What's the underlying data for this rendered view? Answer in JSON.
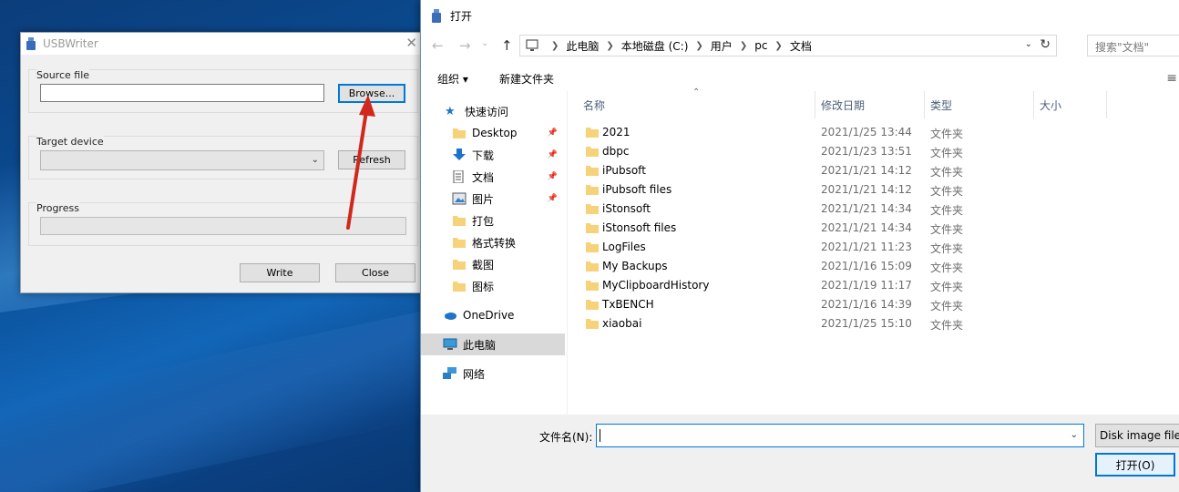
{
  "usbwriter": {
    "title": "USBWriter",
    "close_glyph": "✕",
    "source_file": {
      "label": "Source file",
      "value": "",
      "browse_label": "Browse..."
    },
    "target_device": {
      "label": "Target device",
      "selected": "",
      "refresh_label": "Refresh"
    },
    "progress": {
      "label": "Progress",
      "value_fraction": 0
    },
    "write_label": "Write",
    "close_label": "Close"
  },
  "dialog": {
    "title": "打开",
    "breadcrumb": [
      "此电脑",
      "本地磁盘 (C:)",
      "用户",
      "pc",
      "文档"
    ],
    "search_placeholder": "搜索\"文档\"",
    "toolbar": {
      "organize_label": "组织 ▾",
      "new_folder_label": "新建文件夹"
    },
    "nav": {
      "quick_access": "快速访问",
      "quick_items": [
        {
          "label": "Desktop",
          "icon": "folder-blue-icon",
          "pinned": true
        },
        {
          "label": "下载",
          "icon": "download-icon",
          "pinned": true
        },
        {
          "label": "文档",
          "icon": "document-icon",
          "pinned": true
        },
        {
          "label": "图片",
          "icon": "picture-icon",
          "pinned": true
        },
        {
          "label": "打包",
          "icon": "folder-icon",
          "pinned": false
        },
        {
          "label": "格式转换",
          "icon": "folder-icon",
          "pinned": false
        },
        {
          "label": "截图",
          "icon": "folder-icon",
          "pinned": false
        },
        {
          "label": "图标",
          "icon": "folder-icon",
          "pinned": false
        }
      ],
      "onedrive": "OneDrive",
      "this_pc": "此电脑",
      "network": "网络"
    },
    "columns": {
      "name": "名称",
      "date": "修改日期",
      "type": "类型",
      "size": "大小"
    },
    "files": [
      {
        "name": "2021",
        "date": "2021/1/25 13:44",
        "type": "文件夹"
      },
      {
        "name": "dbpc",
        "date": "2021/1/23 13:51",
        "type": "文件夹"
      },
      {
        "name": "iPubsoft",
        "date": "2021/1/21 14:12",
        "type": "文件夹"
      },
      {
        "name": "iPubsoft files",
        "date": "2021/1/21 14:12",
        "type": "文件夹"
      },
      {
        "name": "iStonsoft",
        "date": "2021/1/21 14:34",
        "type": "文件夹"
      },
      {
        "name": "iStonsoft files",
        "date": "2021/1/21 14:34",
        "type": "文件夹"
      },
      {
        "name": "LogFiles",
        "date": "2021/1/21 11:23",
        "type": "文件夹"
      },
      {
        "name": "My Backups",
        "date": "2021/1/16 15:09",
        "type": "文件夹"
      },
      {
        "name": "MyClipboardHistory",
        "date": "2021/1/19 11:17",
        "type": "文件夹"
      },
      {
        "name": "TxBENCH",
        "date": "2021/1/16 14:39",
        "type": "文件夹"
      },
      {
        "name": "xiaobai",
        "date": "2021/1/25 15:10",
        "type": "文件夹"
      }
    ],
    "filename_label": "文件名(N):",
    "filename_value": "",
    "filter_label": "Disk image files",
    "open_label": "打开(O)"
  },
  "colors": {
    "accent": "#0078d7",
    "folder": "#f6d37a",
    "arrow": "#d0281c"
  }
}
